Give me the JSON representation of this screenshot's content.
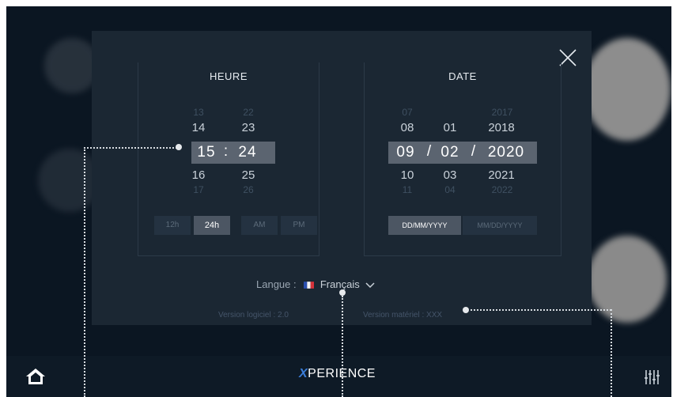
{
  "settings_modal": {
    "time_section": {
      "title": "HEURE",
      "hours": {
        "prev2": "13",
        "prev1": "14",
        "selected": "15",
        "next1": "16",
        "next2": "17"
      },
      "minutes": {
        "prev2": "22",
        "prev1": "23",
        "selected": "24",
        "next1": "25",
        "next2": "26"
      },
      "separator": ":",
      "format_buttons": [
        "12h",
        "24h",
        "AM",
        "PM"
      ],
      "active_format": "24h"
    },
    "date_section": {
      "title": "DATE",
      "days": {
        "prev2": "07",
        "prev1": "08",
        "selected": "09",
        "next1": "10",
        "next2": "11"
      },
      "months": {
        "prev2": "",
        "prev1": "01",
        "selected": "02",
        "next1": "03",
        "next2": "04"
      },
      "years": {
        "prev2": "2017",
        "prev1": "2018",
        "selected": "2020",
        "next1": "2021",
        "next2": "2022"
      },
      "separator": "/",
      "format_buttons": [
        "DD/MM/YYYY",
        "MM/DD/YYYY"
      ],
      "active_format": "DD/MM/YYYY"
    },
    "language": {
      "label": "Langue :",
      "value": "Français"
    },
    "software_version": "Version logiciel : 2.0",
    "hardware_version": "Version matériel : XXX"
  },
  "bottom_bar": {
    "brand_mark": "X",
    "brand_rest": "PERIENCE"
  },
  "icons": {
    "close": "close-icon",
    "home": "home-icon",
    "settings": "sliders-icon",
    "dropdown": "chevron-down-icon"
  },
  "colors": {
    "accent": "#3b7dd8",
    "background": "#0b1622",
    "panel": "#1b2733"
  }
}
